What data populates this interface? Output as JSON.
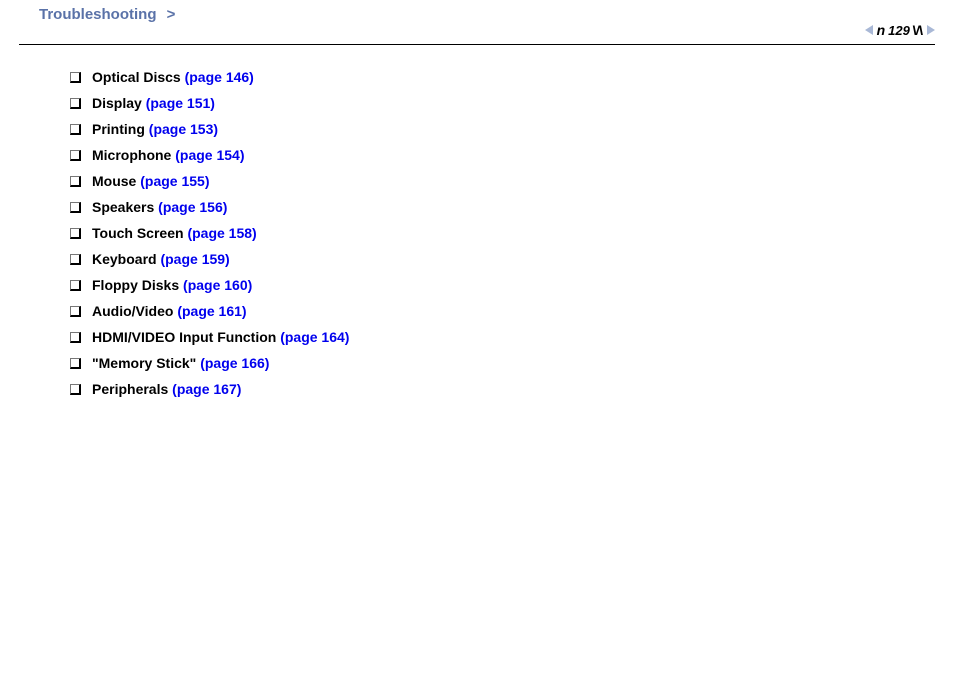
{
  "header": {
    "breadcrumb": "Troubleshooting",
    "separator": ">",
    "page_number": "129"
  },
  "nav": {
    "prev_icon": "triangle-left",
    "next_icon": "triangle-right"
  },
  "items": [
    {
      "label": "Optical Discs ",
      "link": "(page 146)"
    },
    {
      "label": "Display ",
      "link": "(page 151)"
    },
    {
      "label": "Printing ",
      "link": "(page 153)"
    },
    {
      "label": "Microphone ",
      "link": "(page 154)"
    },
    {
      "label": "Mouse ",
      "link": "(page 155)"
    },
    {
      "label": "Speakers ",
      "link": "(page 156)"
    },
    {
      "label": "Touch Screen ",
      "link": "(page 158)"
    },
    {
      "label": "Keyboard ",
      "link": "(page 159)"
    },
    {
      "label": "Floppy Disks ",
      "link": "(page 160)"
    },
    {
      "label": "Audio/Video ",
      "link": "(page 161)"
    },
    {
      "label": "HDMI/VIDEO Input Function ",
      "link": "(page 164)"
    },
    {
      "label": "\"Memory Stick\" ",
      "link": "(page 166)"
    },
    {
      "label": "Peripherals ",
      "link": "(page 167)"
    }
  ]
}
